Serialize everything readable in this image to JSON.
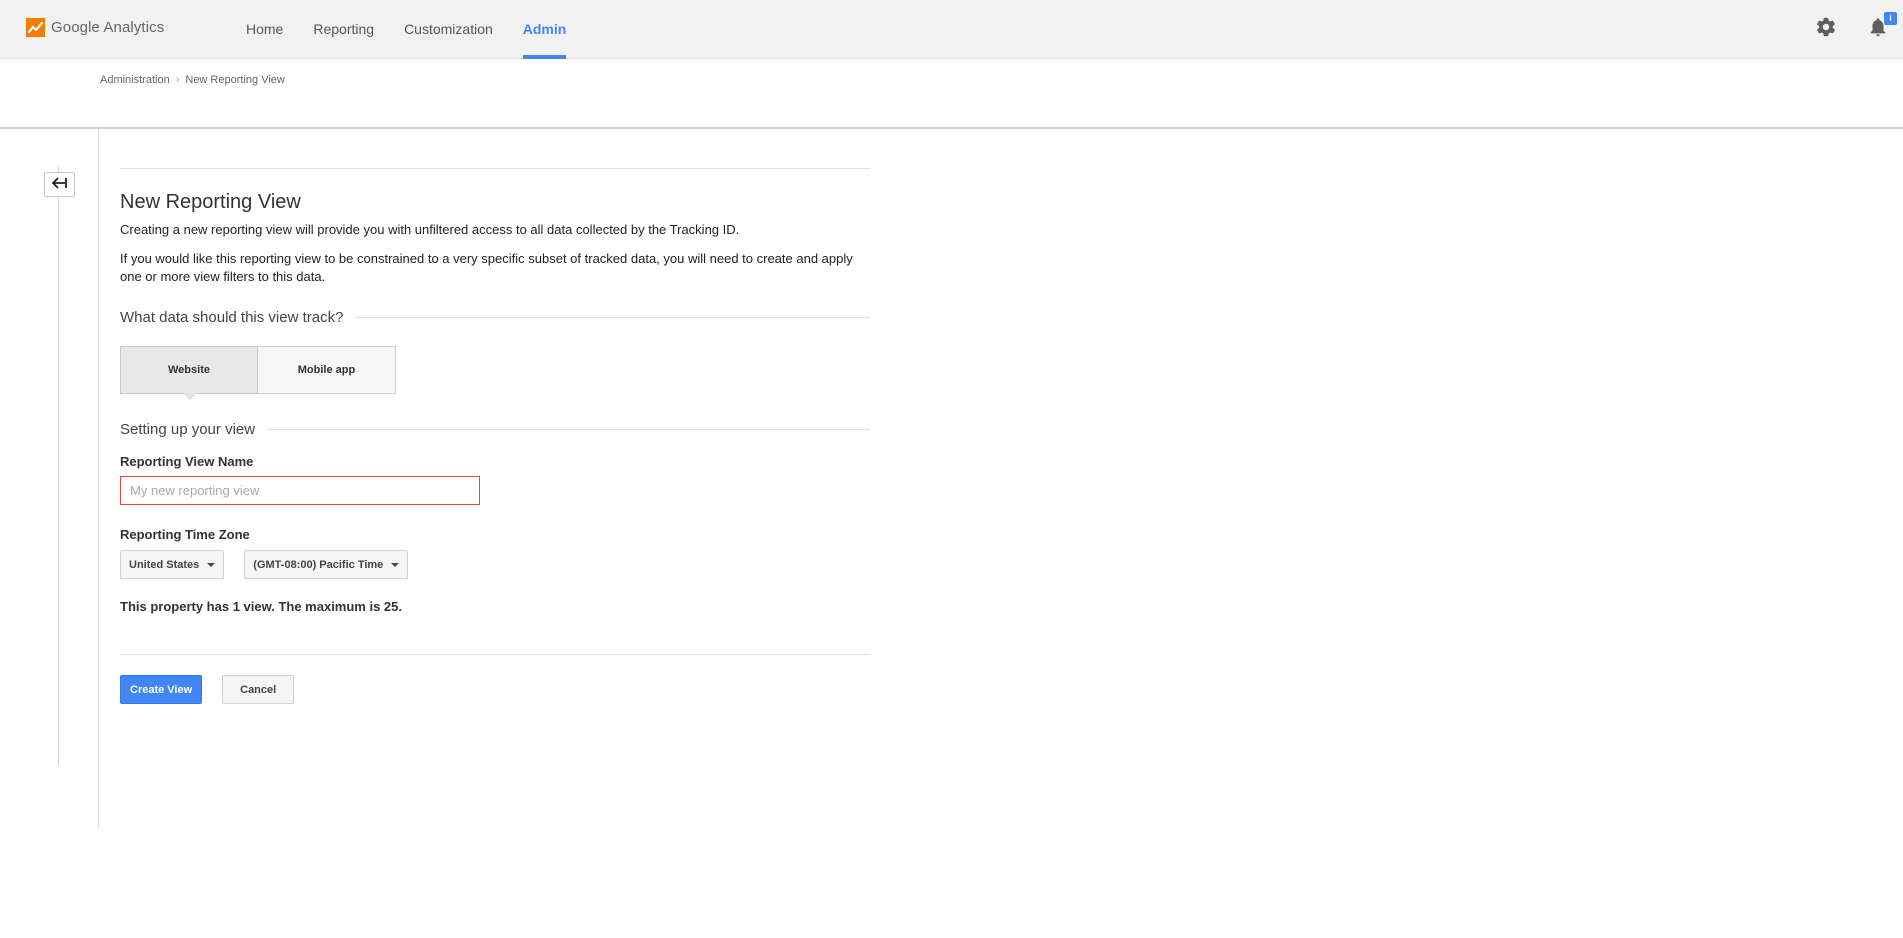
{
  "app": {
    "name": "Google Analytics",
    "accent_color": "#4285f4",
    "logo_color": "#f57c00"
  },
  "nav": {
    "items": [
      {
        "label": "Home"
      },
      {
        "label": "Reporting"
      },
      {
        "label": "Customization"
      },
      {
        "label": "Admin"
      }
    ],
    "active": "Admin"
  },
  "top_icons": {
    "settings": "gear-icon",
    "notifications": "bell-icon",
    "notification_badge": "i"
  },
  "breadcrumb": {
    "root": "Administration",
    "current": "New Reporting View"
  },
  "form": {
    "title": "New Reporting View",
    "description1": "Creating a new reporting view will provide you with unfiltered access to all data collected by the Tracking ID.",
    "description2": "If you would like this reporting view to be constrained to a very specific subset of tracked data, you will need to create and apply one or more view filters to this data.",
    "track_section": "What data should this view track?",
    "track_options": [
      {
        "label": "Website",
        "selected": true
      },
      {
        "label": "Mobile app",
        "selected": false
      }
    ],
    "setup_section": "Setting up your view",
    "view_name_label": "Reporting View Name",
    "view_name_value": "",
    "view_name_placeholder": "My new reporting view",
    "timezone_label": "Reporting Time Zone",
    "country_select": "United States",
    "timezone_select": "(GMT-08:00) Pacific Time",
    "view_count_info": "This property has 1 view. The maximum is 25.",
    "create_button": "Create View",
    "cancel_button": "Cancel"
  }
}
